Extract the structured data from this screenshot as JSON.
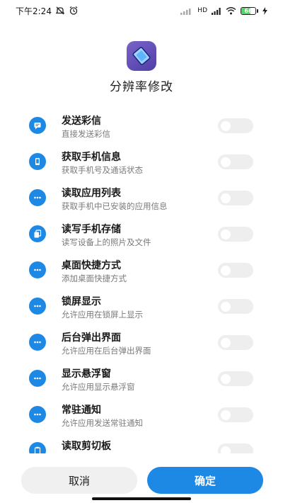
{
  "status_bar": {
    "time": "下午2:24",
    "network": "HD",
    "battery": {
      "text": "66",
      "level": 0.66
    },
    "icons": [
      "mute-icon",
      "alarm-icon",
      "signal-icon",
      "wifi-icon",
      "battery-icon"
    ]
  },
  "app": {
    "title": "分辨率修改",
    "logo_colors": [
      "#7a63c9",
      "#4f3fa6"
    ]
  },
  "permissions": [
    {
      "title": "发送彩信",
      "desc": "直接发送彩信",
      "icon": "message-icon",
      "enabled": false
    },
    {
      "title": "获取手机信息",
      "desc": "获取手机号及通话状态",
      "icon": "phone-info-icon",
      "enabled": false
    },
    {
      "title": "读取应用列表",
      "desc": "获取手机中已安装的应用信息",
      "icon": "more-icon",
      "enabled": false
    },
    {
      "title": "读写手机存储",
      "desc": "读写设备上的照片及文件",
      "icon": "storage-icon",
      "enabled": false
    },
    {
      "title": "桌面快捷方式",
      "desc": "添加桌面快捷方式",
      "icon": "more-icon",
      "enabled": false
    },
    {
      "title": "锁屏显示",
      "desc": "允许应用在锁屏上显示",
      "icon": "more-icon",
      "enabled": false
    },
    {
      "title": "后台弹出界面",
      "desc": "允许应用在后台弹出界面",
      "icon": "more-icon",
      "enabled": false
    },
    {
      "title": "显示悬浮窗",
      "desc": "允许应用显示悬浮窗",
      "icon": "more-icon",
      "enabled": false
    },
    {
      "title": "常驻通知",
      "desc": "允许应用发送常驻通知",
      "icon": "more-icon",
      "enabled": false
    },
    {
      "title": "读取剪切板",
      "desc": "",
      "icon": "clipboard-icon",
      "enabled": false
    }
  ],
  "buttons": {
    "cancel": "取消",
    "confirm": "确定"
  },
  "colors": {
    "accent": "#1e88e5",
    "toggle_off": "#eeeeee",
    "cancel_bg": "#f0f0f0"
  }
}
